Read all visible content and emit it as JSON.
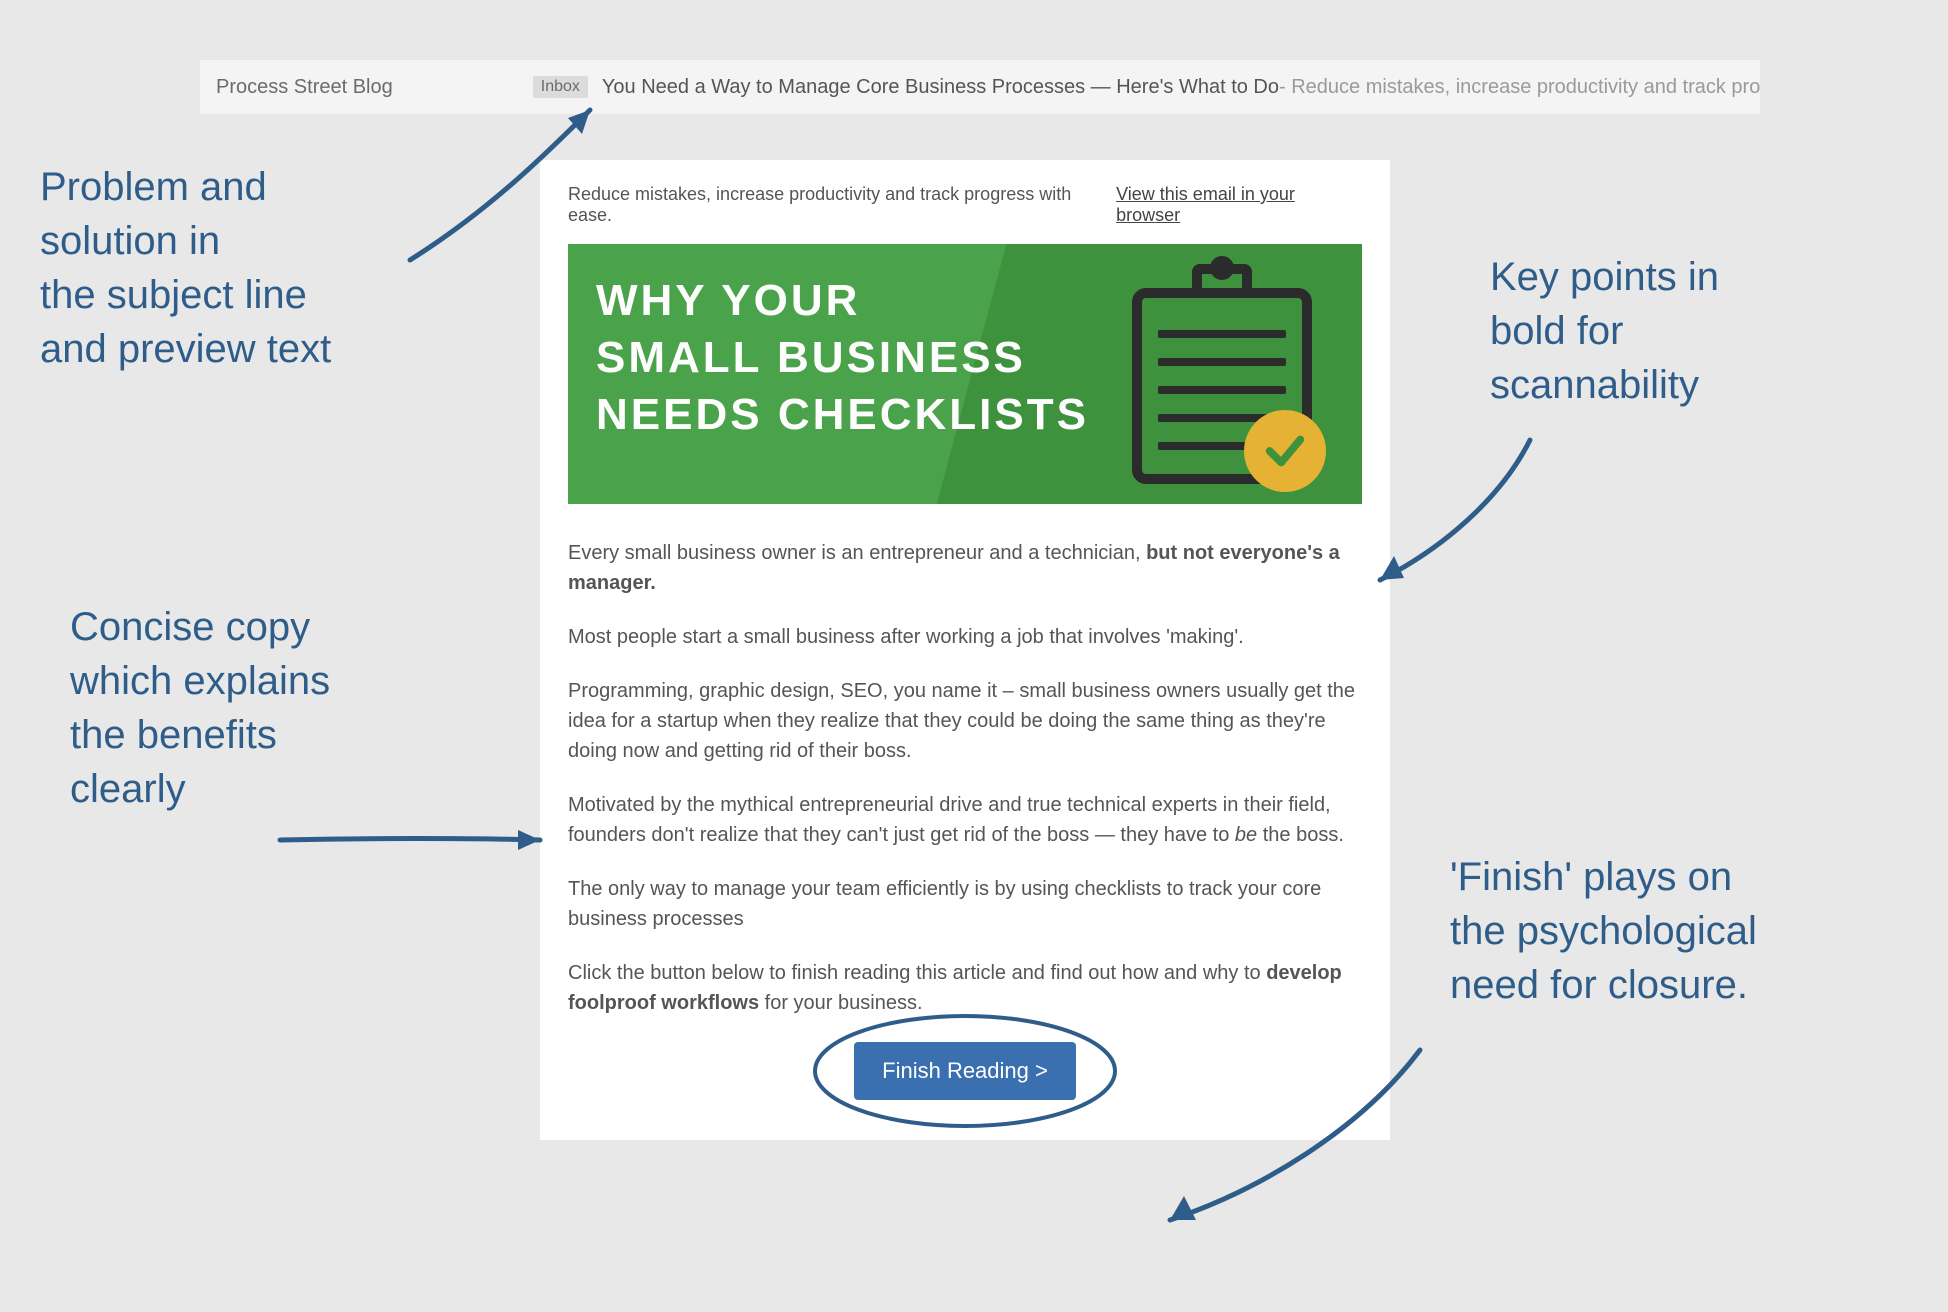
{
  "subject": {
    "sender": "Process Street Blog",
    "tag": "Inbox",
    "line": "You Need a Way to Manage Core Business Processes — Here's What to Do",
    "preview": " - Reduce mistakes, increase productivity and track progress with ease."
  },
  "email": {
    "preheader": "Reduce mistakes, increase productivity and track progress with ease.",
    "view_link": "View this email in your browser",
    "hero": {
      "line1": "WHY YOUR",
      "line2": "SMALL BUSINESS",
      "line3": "NEEDS CHECKLISTS"
    },
    "para1_plain": "Every small business owner is an entrepreneur and a technician, ",
    "para1_bold": "but not everyone's a manager.",
    "para2": "Most people start a small business after working a job that involves 'making'.",
    "para3": "Programming, graphic design, SEO, you name it – small business owners usually get the idea for a startup when they realize that they could be doing the same thing as they're doing now and getting rid of their boss.",
    "para4_a": "Motivated by the mythical entrepreneurial drive and true technical experts in their field, founders don't realize that they can't just get rid of the boss — they have to ",
    "para4_it": "be",
    "para4_b": " the boss.",
    "para5": "The only way to manage your team efficiently is by using checklists to track your core business processes",
    "para6_a": "Click the button below to finish reading this article and find out how and why to ",
    "para6_bold": "develop foolproof workflows",
    "para6_b": " for your business.",
    "cta": "Finish Reading >"
  },
  "annotations": {
    "top_left": [
      "Problem and",
      "solution in",
      "the subject line",
      "and preview text"
    ],
    "mid_left": [
      "Concise copy",
      "which explains",
      "the benefits",
      "clearly"
    ],
    "top_right": [
      "Key points in",
      "bold for",
      "scannability"
    ],
    "bot_right": [
      "'Finish' plays on",
      "the psychological",
      "need for closure."
    ]
  }
}
